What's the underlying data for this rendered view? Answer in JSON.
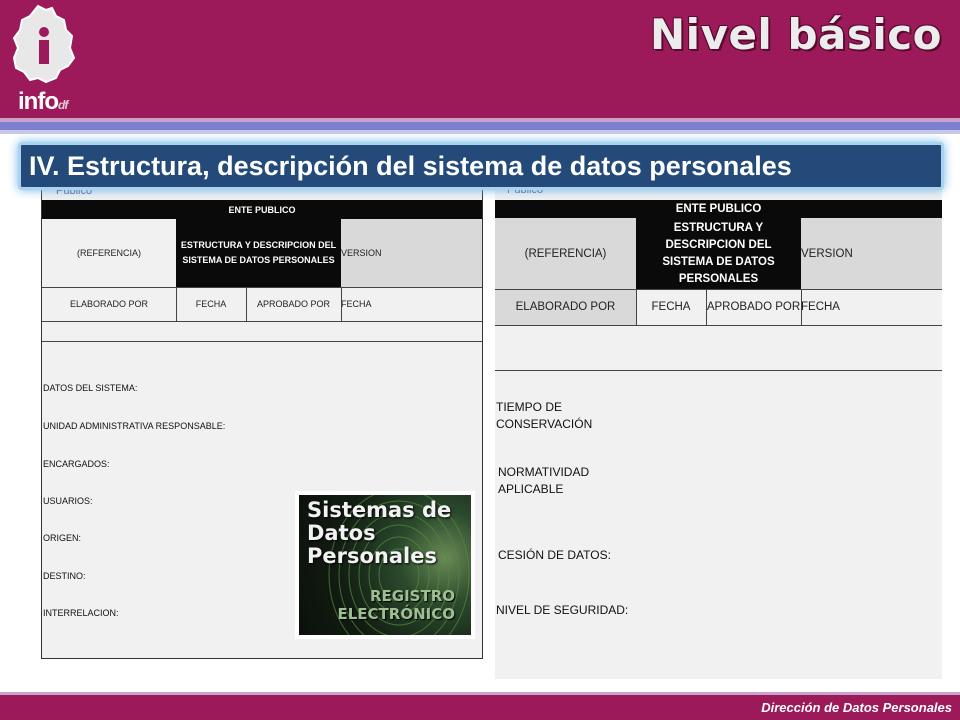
{
  "header": {
    "logo_text": "info",
    "logo_suffix": "df",
    "title": "Nivel básico"
  },
  "banner": {
    "title": "IV. Estructura, descripción del sistema de datos personales"
  },
  "left_form": {
    "top_text": "Público",
    "ente": "ENTE PUBLICO",
    "referencia": "(REFERENCIA)",
    "estructura": "ESTRUCTURA  Y DESCRIPCION DEL SISTEMA DE DATOS PERSONALES",
    "version": "VERSION",
    "elaborado": "ELABORADO POR",
    "fecha1": "FECHA",
    "aprobado": "APROBADO POR",
    "fecha2": "FECHA",
    "fields": [
      "DATOS DEL SISTEMA:",
      "UNIDAD ADMINISTRATIVA  RESPONSABLE:",
      "ENCARGADOS:",
      "USUARIOS:",
      "ORIGEN:",
      "DESTINO:",
      "INTERRELACION:"
    ]
  },
  "image": {
    "title_line1": "Sistemas de",
    "title_line2": "Datos",
    "title_line3": "Personales",
    "sub_line1": "REGISTRO",
    "sub_line2": "ELECTRÓNICO"
  },
  "right_form": {
    "top_text": "Público",
    "ente": "ENTE PUBLICO",
    "referencia": "(REFERENCIA)",
    "estructura": "ESTRUCTURA Y DESCRIPCION DEL SISTEMA DE DATOS PERSONALES",
    "version": "VERSION",
    "elaborado": "ELABORADO POR",
    "fecha1": "FECHA",
    "aprobado": "APROBADO POR",
    "fecha2": "FECHA",
    "fields": [
      "TIEMPO DE CONSERVACIÓN",
      "NORMATIVIDAD APLICABLE",
      "CESIÓN DE DATOS:",
      "NIVEL DE SEGURIDAD:"
    ]
  },
  "footer": {
    "text": "Dirección de Datos Personales"
  },
  "colors": {
    "header_bg": "#9c1a5a",
    "banner_bg": "#234a79",
    "banner_glow": "#6fb6e8"
  }
}
